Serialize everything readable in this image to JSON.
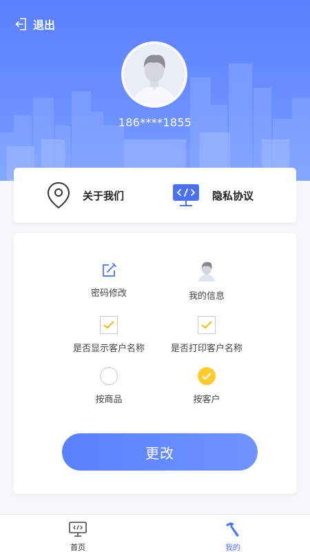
{
  "header": {
    "logout_label": "退出",
    "phone": "186****1855"
  },
  "links": [
    {
      "label": "关于我们",
      "icon": "location-pin-icon"
    },
    {
      "label": "隐私协议",
      "icon": "code-monitor-icon"
    }
  ],
  "settings": {
    "password_label": "密码修改",
    "info_label": "我的信息",
    "show_customer_label": "是否显示客户名称",
    "print_customer_label": "是否打印客户名称",
    "by_product_label": "按商品",
    "by_customer_label": "按客户",
    "show_customer_checked": true,
    "print_customer_checked": true,
    "selected_mode": "按客户",
    "submit_label": "更改"
  },
  "tabs": [
    {
      "label": "首页",
      "icon": "monitor-icon",
      "active": false
    },
    {
      "label": "我的",
      "icon": "hammer-icon",
      "active": true
    }
  ],
  "colors": {
    "primary": "#5a80ff",
    "accent_yellow": "#ffcb2f",
    "tab_active": "#4d76f5"
  }
}
